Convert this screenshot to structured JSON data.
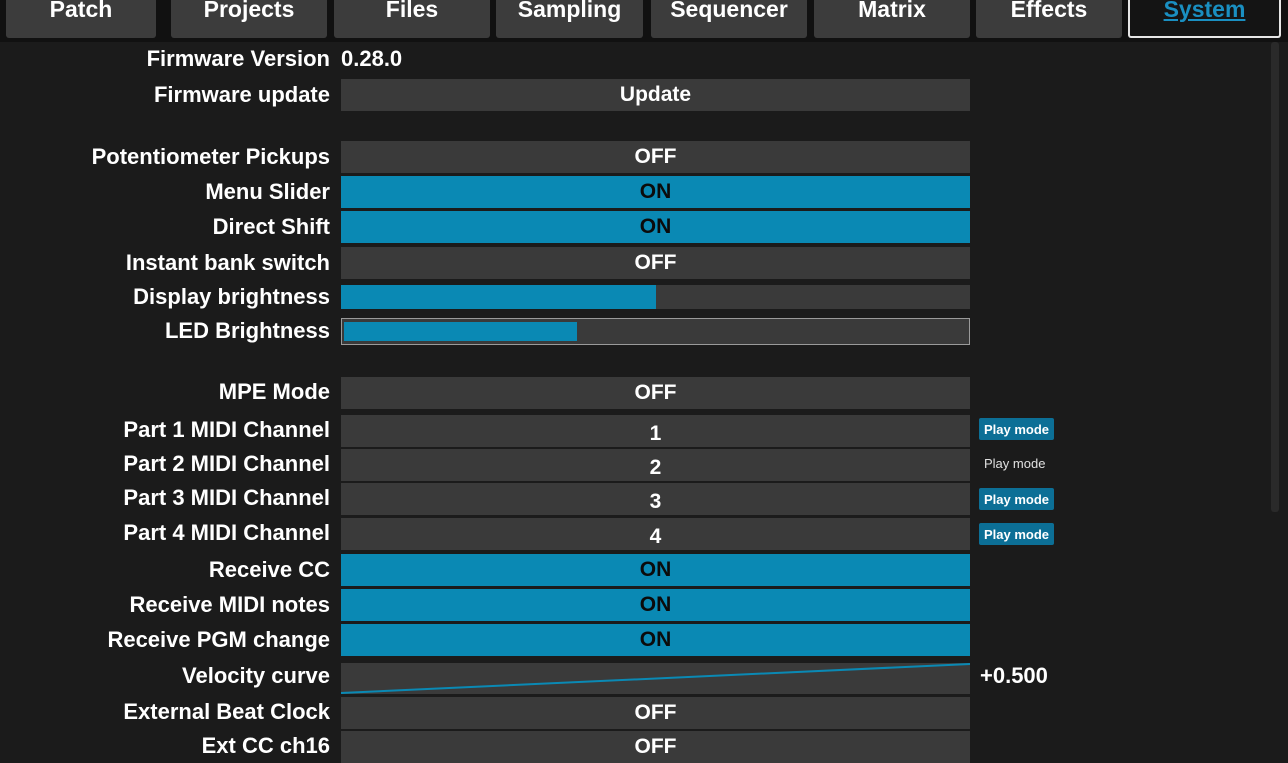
{
  "tabs": [
    {
      "label": "Patch"
    },
    {
      "label": "Projects"
    },
    {
      "label": "Files"
    },
    {
      "label": "Sampling"
    },
    {
      "label": "Sequencer"
    },
    {
      "label": "Matrix"
    },
    {
      "label": "Effects"
    },
    {
      "label": "System"
    }
  ],
  "active_tab": "System",
  "colors": {
    "accent": "#0a89b4",
    "background": "#1b1b1b",
    "field": "#3a3a3a"
  },
  "settings": {
    "firmware_version": {
      "label": "Firmware Version",
      "value": "0.28.0"
    },
    "firmware_update": {
      "label": "Firmware update",
      "value": "Update"
    },
    "potentiometer_pickups": {
      "label": "Potentiometer Pickups",
      "value": "OFF"
    },
    "menu_slider": {
      "label": "Menu Slider",
      "value": "ON"
    },
    "direct_shift": {
      "label": "Direct Shift",
      "value": "ON"
    },
    "instant_bank_switch": {
      "label": "Instant bank switch",
      "value": "OFF"
    },
    "display_brightness": {
      "label": "Display brightness",
      "level": 0.5
    },
    "led_brightness": {
      "label": "LED Brightness",
      "level": 0.375
    },
    "mpe_mode": {
      "label": "MPE Mode",
      "value": "OFF"
    },
    "part1_midi": {
      "label": "Part 1 MIDI Channel",
      "value": "1",
      "badge": "Play mode",
      "badge_active": true
    },
    "part2_midi": {
      "label": "Part 2 MIDI Channel",
      "value": "2",
      "badge": "Play mode",
      "badge_active": false
    },
    "part3_midi": {
      "label": "Part 3 MIDI Channel",
      "value": "3",
      "badge": "Play mode",
      "badge_active": true
    },
    "part4_midi": {
      "label": "Part 4 MIDI Channel",
      "value": "4",
      "badge": "Play mode",
      "badge_active": true
    },
    "receive_cc": {
      "label": "Receive CC",
      "value": "ON"
    },
    "receive_midi_notes": {
      "label": "Receive MIDI notes",
      "value": "ON"
    },
    "receive_pgm_change": {
      "label": "Receive PGM change",
      "value": "ON"
    },
    "velocity_curve": {
      "label": "Velocity curve",
      "value": "+0.500"
    },
    "external_beat_clock": {
      "label": "External Beat Clock",
      "value": "OFF"
    },
    "ext_cc_ch16": {
      "label": "Ext CC ch16",
      "value": "OFF"
    }
  }
}
